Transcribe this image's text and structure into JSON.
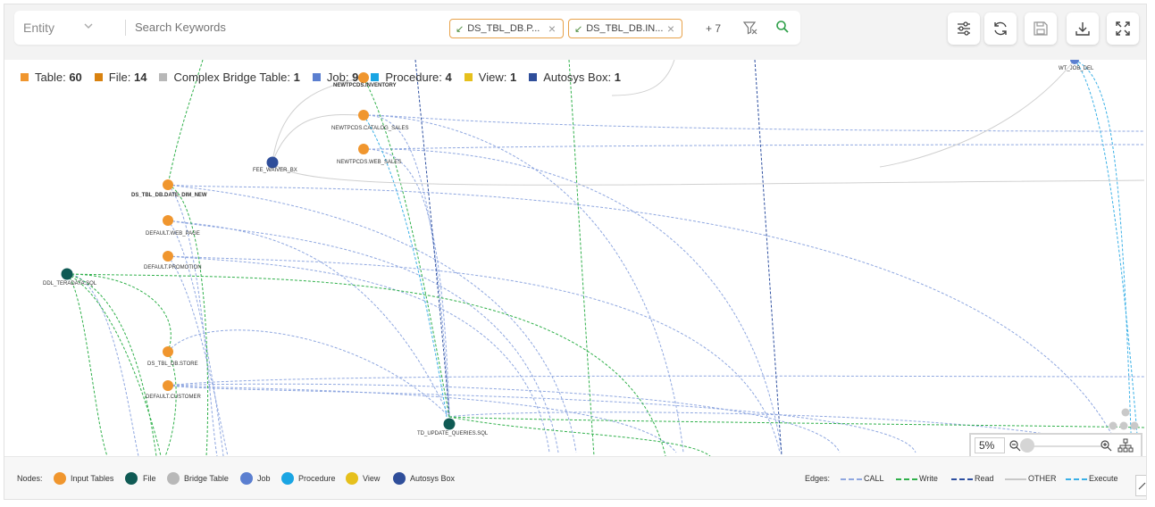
{
  "toolbar": {
    "entity_label": "Entity",
    "search_placeholder": "Search Keywords",
    "chips": [
      "DS_TBL_DB.P...",
      "DS_TBL_DB.IN..."
    ],
    "more_count": "+ 7",
    "zoom_value": "5%"
  },
  "legend": [
    {
      "name": "Table:",
      "count": "60",
      "color": "#f0962e"
    },
    {
      "name": "File:",
      "count": "14",
      "color": "#d9820f"
    },
    {
      "name": "Complex Bridge Table:",
      "count": "1",
      "color": "#b8b8b8"
    },
    {
      "name": "Job:",
      "count": "9",
      "color": "#5b7fd0"
    },
    {
      "name": "Procedure:",
      "count": "4",
      "color": "#1aa5e3"
    },
    {
      "name": "View:",
      "count": "1",
      "color": "#e6c01c"
    },
    {
      "name": "Autosys Box:",
      "count": "1",
      "color": "#2f4e9a"
    }
  ],
  "nodes": {
    "inventory": "NEWTPCDS.INVENTORY",
    "catalog_sales": "NEWTPCDS.CATALOG_SALES",
    "web_sales": "NEWTPCDS.WEB_SALES",
    "fee_waiver": "FEE_WAIVER_BX",
    "date_dim": "DS_TBL_DB.DATE_DIM_NEW",
    "web_page": "DEFAULT.WEB_PAGE",
    "promotion": "DEFAULT.PROMOTION",
    "ddl_teradata": "DDL_TERADATA.SQL",
    "store": "DS_TBL_DB.STORE",
    "customer": "DEFAULT.CUSTOMER",
    "td_update": "TD_UPDATE_QUERIES.SQL",
    "wt_job": "WT_JOB_DEL"
  },
  "bottom": {
    "nodes_label": "Nodes:",
    "node_types": [
      "Input Tables",
      "File",
      "Bridge Table",
      "Job",
      "Procedure",
      "View",
      "Autosys Box"
    ],
    "edges_label": "Edges:",
    "edge_types": [
      "CALL",
      "Write",
      "Read",
      "OTHER",
      "Execute"
    ]
  },
  "colors": {
    "table": "#f0962e",
    "file": "#0f5a54",
    "job": "#5b7fd0",
    "autosys": "#2f4e9a",
    "call": "#8fa7e0",
    "write": "#2fb04a",
    "read": "#2d4fa0",
    "other": "#c8c8c8",
    "execute": "#3ab0e6"
  }
}
